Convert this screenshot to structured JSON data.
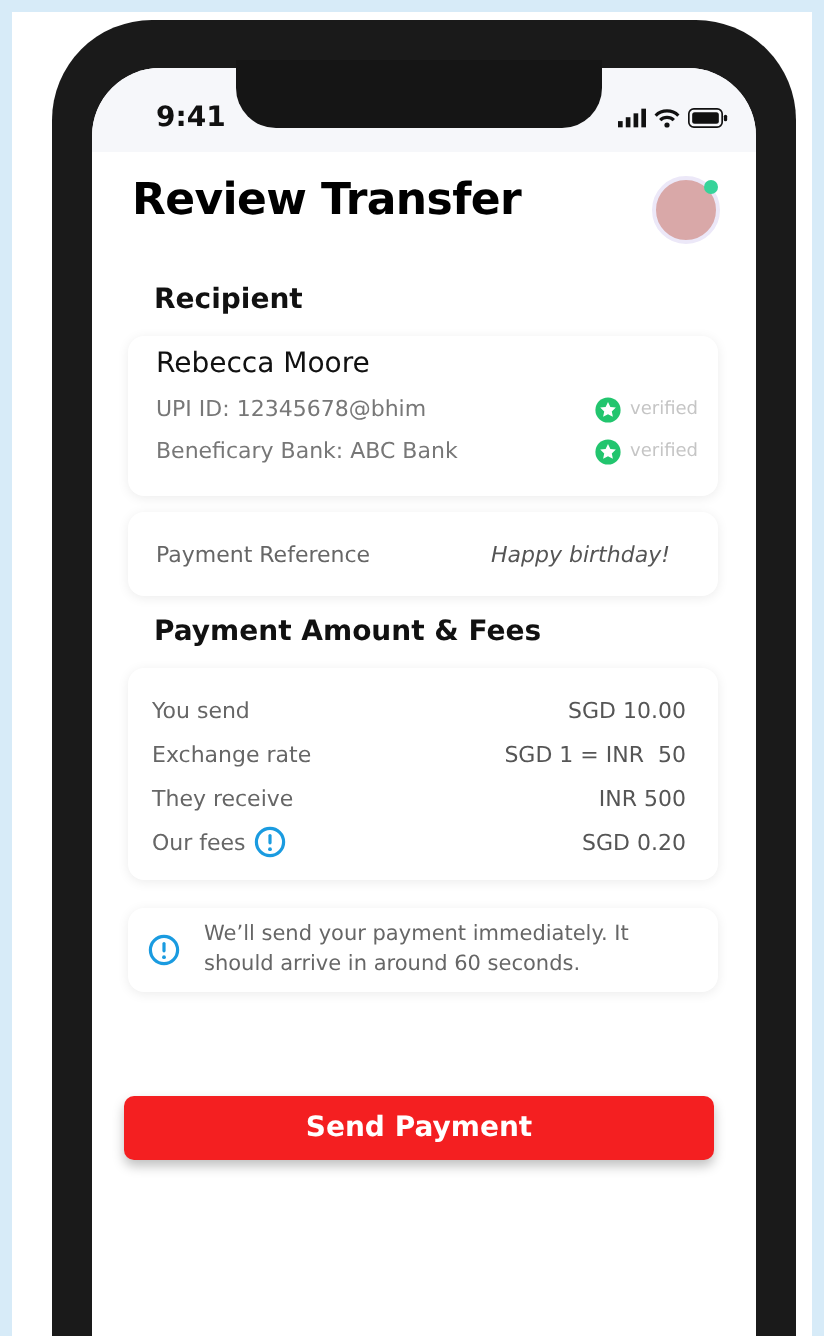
{
  "status_bar": {
    "time": "9:41"
  },
  "header": {
    "title": "Review Transfer",
    "avatar": {
      "online": true
    }
  },
  "recipient": {
    "heading": "Recipient",
    "name": "Rebecca Moore",
    "details": [
      {
        "label": "UPI ID: 12345678@bhim",
        "badge": "verified"
      },
      {
        "label": "Beneficary Bank: ABC Bank",
        "badge": "verified"
      }
    ]
  },
  "reference": {
    "label": "Payment Reference",
    "value": "Happy birthday!"
  },
  "amounts": {
    "heading": "Payment Amount & Fees",
    "rows": [
      {
        "label": "You send",
        "value": "SGD 10.00",
        "info": false
      },
      {
        "label": "Exchange rate",
        "value": "SGD 1 = INR  50",
        "info": false
      },
      {
        "label": "They receive",
        "value": "INR 500",
        "info": false
      },
      {
        "label": "Our fees",
        "value": "SGD 0.20",
        "info": true
      }
    ]
  },
  "notice": {
    "text": "We’ll send your payment immediately. It should arrive in around 60 seconds."
  },
  "button": {
    "label": "Send Payment"
  }
}
